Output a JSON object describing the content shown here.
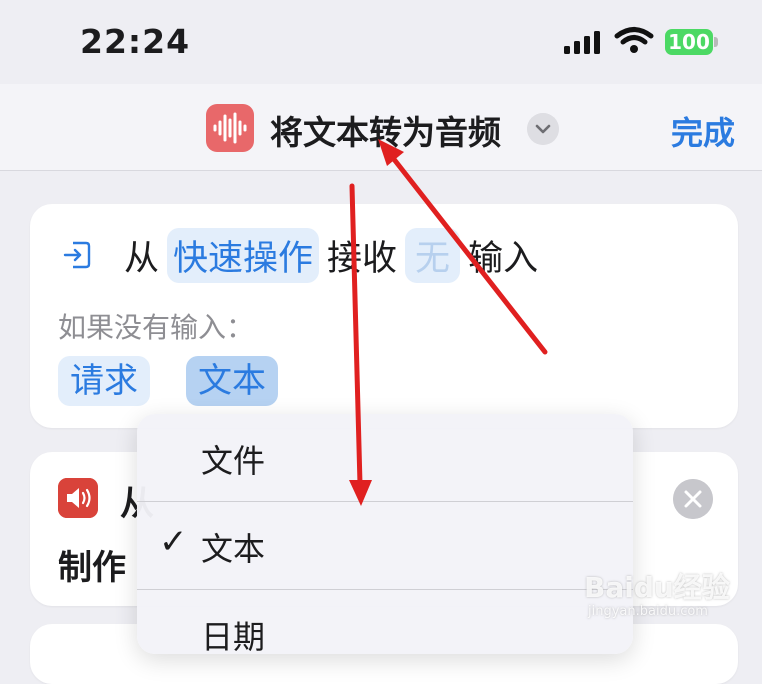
{
  "status_bar": {
    "time": "22:24",
    "battery": "100"
  },
  "nav": {
    "title": "将文本转为音频",
    "done_label": "完成",
    "app_icon": "waveform-icon"
  },
  "receive_card": {
    "from_label": "从",
    "source_token": "快速操作",
    "receive_label": "接收",
    "none_token": "无",
    "input_label": "输入",
    "if_no_input_label": "如果没有输入：",
    "chip_request": "请求",
    "chip_text": "文本"
  },
  "speak_card": {
    "line1_partial": "从",
    "line2_partial": "制作"
  },
  "dropdown": {
    "items": [
      {
        "label": "文件",
        "checked": false
      },
      {
        "label": "文本",
        "checked": true
      },
      {
        "label": "日期",
        "checked": false
      }
    ]
  },
  "watermark": {
    "brand": "Baidu经验",
    "url": "jingyan.baidu.com"
  },
  "colors": {
    "accent": "#2b7be0",
    "app_icon": "#e8686a",
    "speaker_icon": "#d9433a",
    "annotation_arrow": "#e02020"
  }
}
